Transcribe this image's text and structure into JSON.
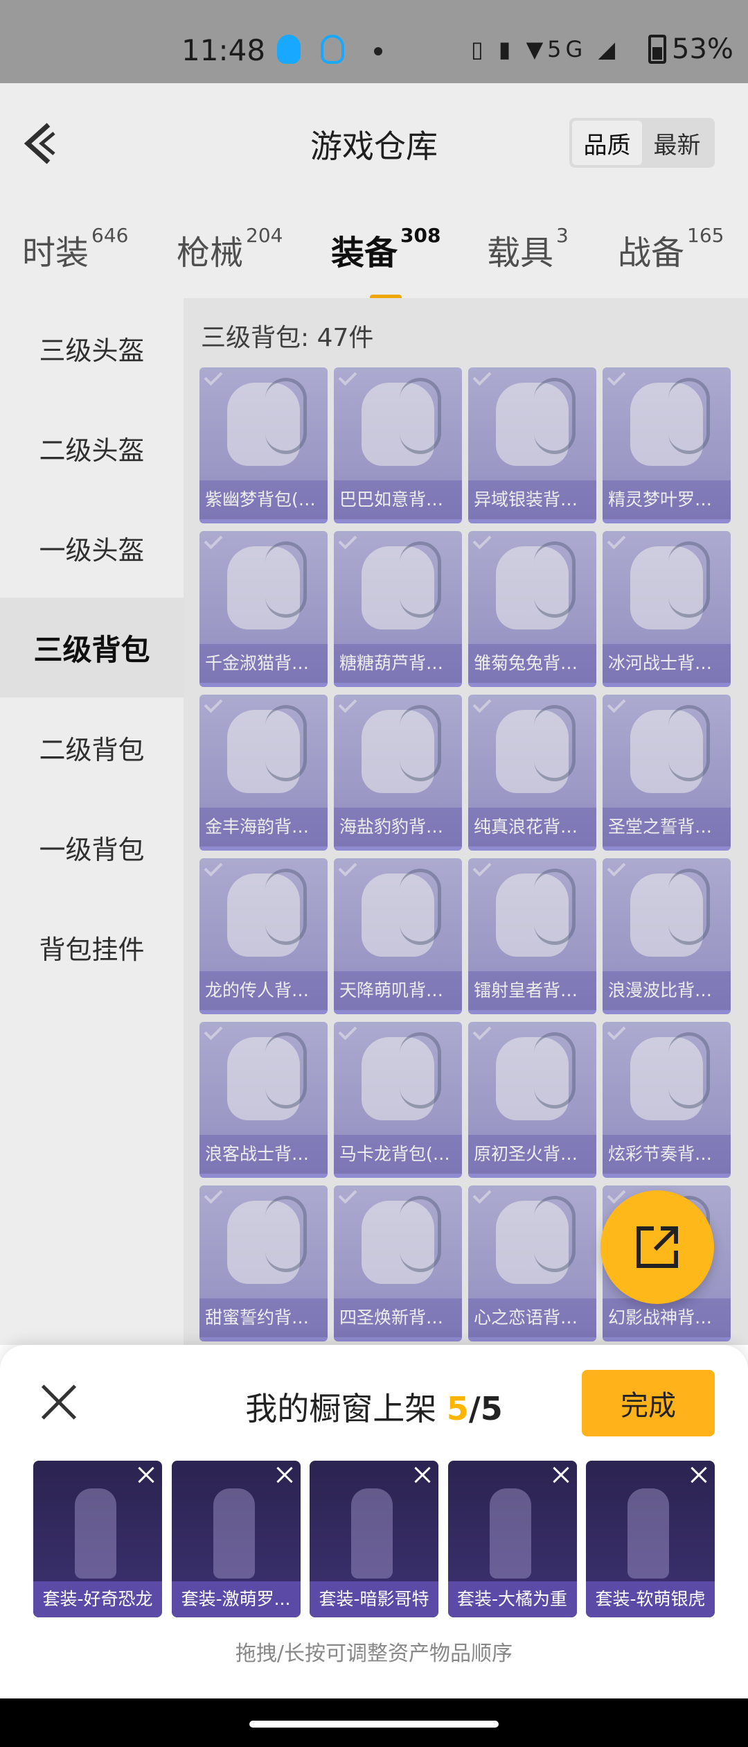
{
  "status": {
    "time": "11:48",
    "network": "5G",
    "battery": "53%"
  },
  "header": {
    "title": "游戏仓库",
    "sort": [
      "品质",
      "最新"
    ]
  },
  "tabs": [
    {
      "label": "时装",
      "count": "646"
    },
    {
      "label": "枪械",
      "count": "204"
    },
    {
      "label": "装备",
      "count": "308"
    },
    {
      "label": "载具",
      "count": "3"
    },
    {
      "label": "战备",
      "count": "165"
    }
  ],
  "sidebar": [
    "三级头盔",
    "二级头盔",
    "一级头盔",
    "三级背包",
    "二级背包",
    "一级背包",
    "背包挂件"
  ],
  "section_title": "三级背包: 47件",
  "items": [
    "紫幽梦背包(3...",
    "巴巴如意背包...",
    "异域银装背包...",
    "精灵梦叶罗丽...",
    "千金淑猫背包...",
    "糖糖葫芦背包...",
    "雏菊兔兔背包...",
    "冰河战士背包...",
    "金丰海韵背包...",
    "海盐豹豹背包...",
    "纯真浪花背包...",
    "圣堂之誓背包...",
    "龙的传人背包...",
    "天降萌叽背包...",
    "镭射皇者背包...",
    "浪漫波比背包...",
    "浪客战士背包...",
    "马卡龙背包(3...",
    "原初圣火背包...",
    "炫彩节奏背包...",
    "甜蜜誓约背包...",
    "四圣焕新背包...",
    "心之恋语背包...",
    "幻影战神背包..."
  ],
  "panel": {
    "title": "我的橱窗上架",
    "count": "5",
    "total": "/5",
    "done": "完成",
    "outfits": [
      "套装-好奇恐龙",
      "套装-激萌罗...",
      "套装-暗影哥特",
      "套装-大橘为重",
      "套装-软萌银虎"
    ],
    "hint": "拖拽/长按可调整资产物品顺序"
  },
  "colors": {
    "accent": "#ffb400",
    "card": "#aaa7d6",
    "outfit": "#2f2658"
  }
}
